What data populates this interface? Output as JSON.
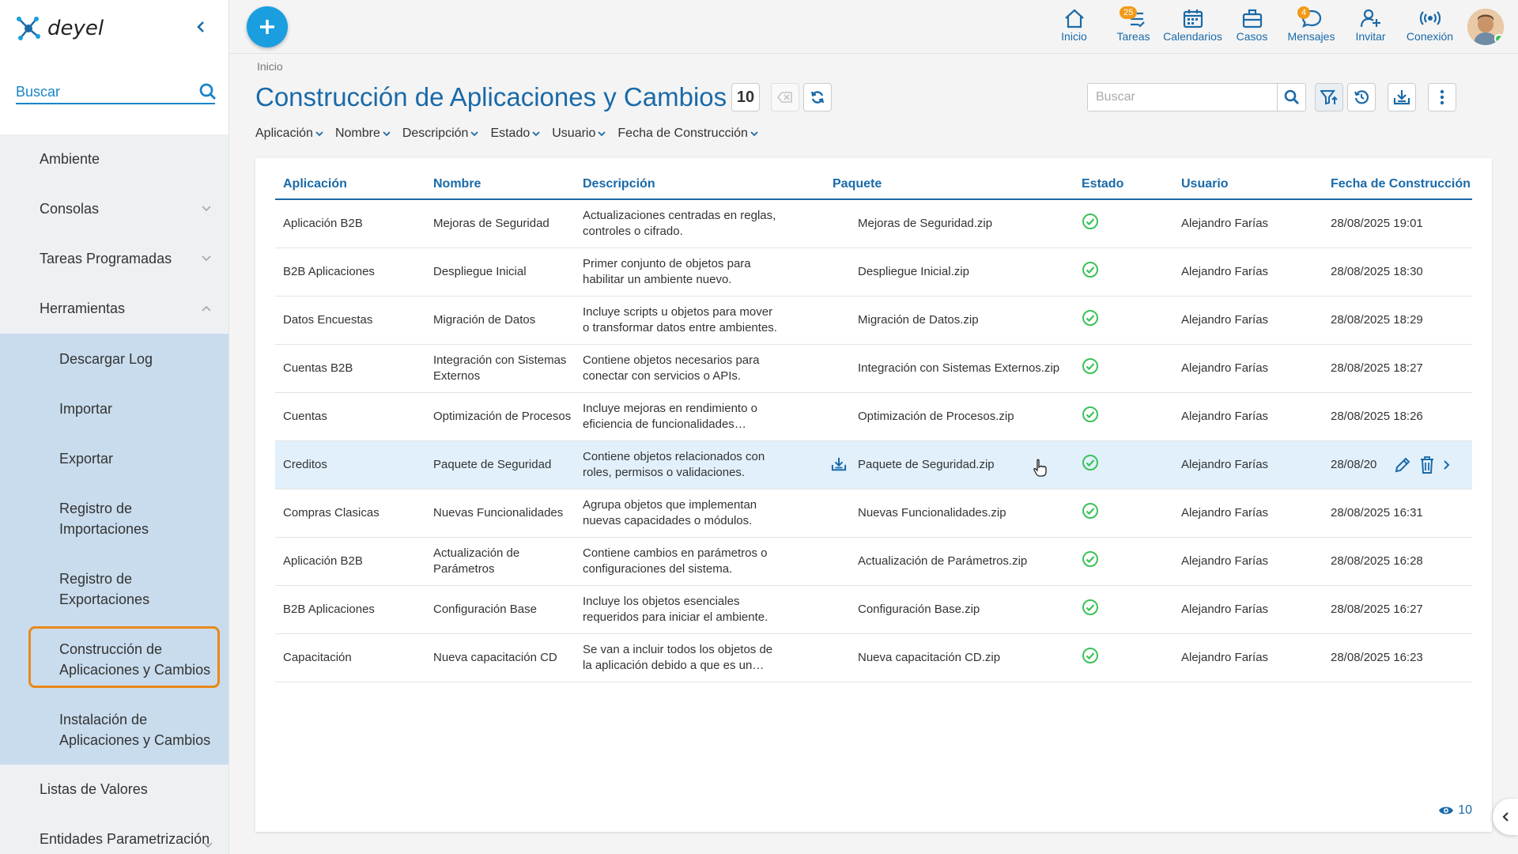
{
  "app": {
    "logo_text": "deyel"
  },
  "sidebar": {
    "search_placeholder": "Buscar",
    "items": [
      {
        "label": "Ambiente"
      },
      {
        "label": "Consolas"
      },
      {
        "label": "Tareas Programadas"
      },
      {
        "label": "Herramientas"
      }
    ],
    "sub_items": [
      {
        "label": "Descargar Log"
      },
      {
        "label": "Importar"
      },
      {
        "label": "Exportar"
      },
      {
        "label": "Registro de Importaciones"
      },
      {
        "label": "Registro de Exportaciones"
      },
      {
        "label": "Construcción de Aplicaciones y Cambios"
      },
      {
        "label": "Instalación de Aplicaciones y Cambios"
      }
    ],
    "bottom_items": [
      {
        "label": "Listas de Valores"
      },
      {
        "label": "Entidades Parametrización"
      }
    ]
  },
  "topnav": {
    "items": [
      {
        "label": "Inicio",
        "icon": "home-icon"
      },
      {
        "label": "Tareas",
        "icon": "tasks-icon",
        "badge": "25"
      },
      {
        "label": "Calendarios",
        "icon": "calendar-icon"
      },
      {
        "label": "Casos",
        "icon": "briefcase-icon"
      },
      {
        "label": "Mensajes",
        "icon": "chat-icon",
        "badge": "4"
      },
      {
        "label": "Invitar",
        "icon": "add-user-icon"
      },
      {
        "label": "Conexión",
        "icon": "connection-icon"
      }
    ]
  },
  "main": {
    "breadcrumb": "Inicio",
    "title": "Construcción de Aplicaciones y Cambios",
    "count": "10",
    "search_placeholder": "Buscar",
    "filters": [
      "Aplicación",
      "Nombre",
      "Descripción",
      "Estado",
      "Usuario",
      "Fecha de Construcción"
    ],
    "columns": [
      "Aplicación",
      "Nombre",
      "Descripción",
      "Paquete",
      "Estado",
      "Usuario",
      "Fecha de Construcción"
    ],
    "rows": [
      {
        "app": "Aplicación B2B",
        "name": "Mejoras de Seguridad",
        "desc": "Actualizaciones centradas en reglas, controles o cifrado.",
        "pkg": "Mejoras de Seguridad.zip",
        "user": "Alejandro Farías",
        "date": "28/08/2025 19:01"
      },
      {
        "app": "B2B Aplicaciones",
        "name": "Despliegue Inicial",
        "desc": "Primer conjunto de objetos para habilitar un ambiente nuevo.",
        "pkg": "Despliegue Inicial.zip",
        "user": "Alejandro Farías",
        "date": "28/08/2025 18:30"
      },
      {
        "app": "Datos Encuestas",
        "name": "Migración de Datos",
        "desc": "Incluye scripts u objetos para mover o transformar datos entre ambientes.",
        "pkg": "Migración de Datos.zip",
        "user": "Alejandro Farías",
        "date": "28/08/2025 18:29"
      },
      {
        "app": "Cuentas B2B",
        "name": "Integración con Sistemas Externos",
        "desc": "Contiene objetos necesarios para conectar con servicios o APIs.",
        "pkg": "Integración con Sistemas Externos.zip",
        "user": "Alejandro Farías",
        "date": "28/08/2025 18:27"
      },
      {
        "app": "Cuentas",
        "name": "Optimización de Procesos",
        "desc": "Incluye mejoras en rendimiento o eficiencia de funcionalidades existentes.",
        "pkg": "Optimización de Procesos.zip",
        "user": "Alejandro Farías",
        "date": "28/08/2025 18:26"
      },
      {
        "app": "Creditos",
        "name": "Paquete de Seguridad",
        "desc": "Contiene objetos relacionados con roles, permisos o validaciones.",
        "pkg": "Paquete de Seguridad.zip",
        "user": "Alejandro Farías",
        "date": "28/08/20"
      },
      {
        "app": "Compras Clasicas",
        "name": "Nuevas Funcionalidades",
        "desc": "Agrupa objetos que implementan nuevas capacidades o módulos.",
        "pkg": "Nuevas Funcionalidades.zip",
        "user": "Alejandro Farías",
        "date": "28/08/2025 16:31"
      },
      {
        "app": "Aplicación B2B",
        "name": "Actualización de Parámetros",
        "desc": "Contiene cambios en parámetros o configuraciones del sistema.",
        "pkg": "Actualización de Parámetros.zip",
        "user": "Alejandro Farías",
        "date": "28/08/2025 16:28"
      },
      {
        "app": "B2B Aplicaciones",
        "name": "Configuración Base",
        "desc": "Incluye los objetos esenciales requeridos para iniciar el ambiente.",
        "pkg": "Configuración Base.zip",
        "user": "Alejandro Farías",
        "date": "28/08/2025 16:27"
      },
      {
        "app": "Capacitación",
        "name": "Nueva capacitación CD",
        "desc": "Se van a incluir todos los objetos de la aplicación debido a que es un desarrollo...",
        "pkg": "Nueva capacitación CD.zip",
        "user": "Alejandro Farías",
        "date": "28/08/2025 16:23"
      }
    ],
    "visible_count": "10"
  },
  "colors": {
    "accent": "#1a6aa8",
    "fab": "#1a9ee0",
    "highlight_frame": "#e8891a",
    "status_ok": "#3cc25a"
  }
}
